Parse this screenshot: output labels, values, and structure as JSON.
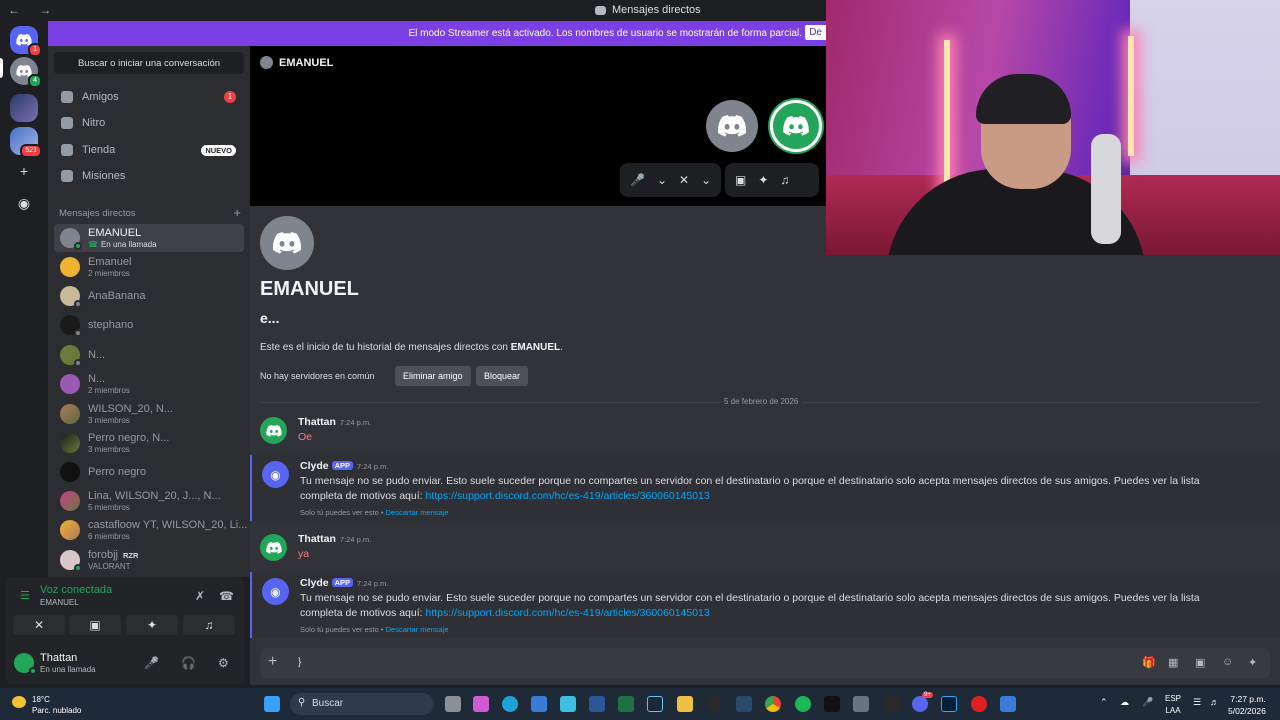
{
  "window": {
    "title": "Mensajes directos",
    "nav": "← →"
  },
  "banner": {
    "text": "El modo Streamer está activado. Los nombres de usuario se mostrarán de forma parcial.",
    "button": "De"
  },
  "rail": {
    "badges": [
      "1",
      "4",
      "521"
    ]
  },
  "sidebar": {
    "search": "Buscar o iniciar una conversación",
    "nav": [
      {
        "label": "Amigos",
        "badge": "1"
      },
      {
        "label": "Nitro"
      },
      {
        "label": "Tienda",
        "tag": "NUEVO"
      },
      {
        "label": "Misiones"
      }
    ],
    "dm_header": "Mensajes directos",
    "dms": [
      {
        "name": "EMANUEL",
        "sub": "En una llamada"
      },
      {
        "name": "Emanuel",
        "sub": "2 miembros"
      },
      {
        "name": "AnaBanana"
      },
      {
        "name": "stephano"
      },
      {
        "name": "N..."
      },
      {
        "name": "N...",
        "sub": "2 miembros"
      },
      {
        "name": "WILSON_20, N...",
        "sub": "3 miembros"
      },
      {
        "name": "Perro negro, N...",
        "sub": "3 miembros"
      },
      {
        "name": "Perro negro"
      },
      {
        "name": "Lina, WILSON_20, J..., N...",
        "sub": "5 miembros"
      },
      {
        "name": "castafloow YT, WILSON_20, Li...",
        "sub": "6 miembros"
      },
      {
        "name": "forobjj",
        "tag": "RZR",
        "sub": "VALORANT"
      }
    ]
  },
  "voice": {
    "title": "Voz conectada",
    "channel": "EMANUEL"
  },
  "user": {
    "name": "Thattan",
    "status": "En una llamada"
  },
  "call": {
    "channel": "EMANUEL"
  },
  "intro": {
    "name": "EMANUEL",
    "handle": "e...",
    "text_prefix": "Este es el inicio de tu historial de mensajes directos con ",
    "text_name": "EMANUEL",
    "text_suffix": ".",
    "no_servers": "No hay servidores en común",
    "remove_friend": "Eliminar amigo",
    "block": "Bloquear"
  },
  "date_divider": "5 de febrero de 2026",
  "messages": [
    {
      "author": "Thattan",
      "time": "7:24 p.m.",
      "text": "Oe"
    },
    {
      "author": "Clyde",
      "app": "APP",
      "time": "7:24 p.m.",
      "text": "Tu mensaje no se pudo enviar. Esto suele suceder porque no compartes un servidor con el destinatario o porque el destinatario solo acepta mensajes directos de sus amigos. Puedes ver la lista completa de motivos aquí: ",
      "link": "https://support.discord.com/hc/es-419/articles/360060145013",
      "only": "Solo tú puedes ver esto • ",
      "dismiss": "Descartar mensaje"
    },
    {
      "author": "Thattan",
      "time": "7:24 p.m.",
      "text": "ya"
    },
    {
      "author": "Clyde",
      "app": "APP",
      "time": "7:24 p.m.",
      "text": "Tu mensaje no se pudo enviar. Esto suele suceder porque no compartes un servidor con el destinatario o porque el destinatario solo acepta mensajes directos de sus amigos. Puedes ver la lista completa de motivos aquí: ",
      "link": "https://support.discord.com/hc/es-419/articles/360060145013",
      "only": "Solo tú puedes ver esto • ",
      "dismiss": "Descartar mensaje"
    }
  ],
  "composer": {
    "value": "}"
  },
  "taskbar": {
    "weather_temp": "18°C",
    "weather_desc": "Parc. nublado",
    "search": "Buscar",
    "lang_1": "ESP",
    "lang_2": "LAA",
    "time": "7:27 p.m.",
    "date": "5/02/2026",
    "discord_badge": "9+"
  },
  "colors": {
    "accent": "#5865f2",
    "streamer_banner": "#7b3fe4",
    "online": "#23a55a",
    "danger": "#f23f43"
  }
}
